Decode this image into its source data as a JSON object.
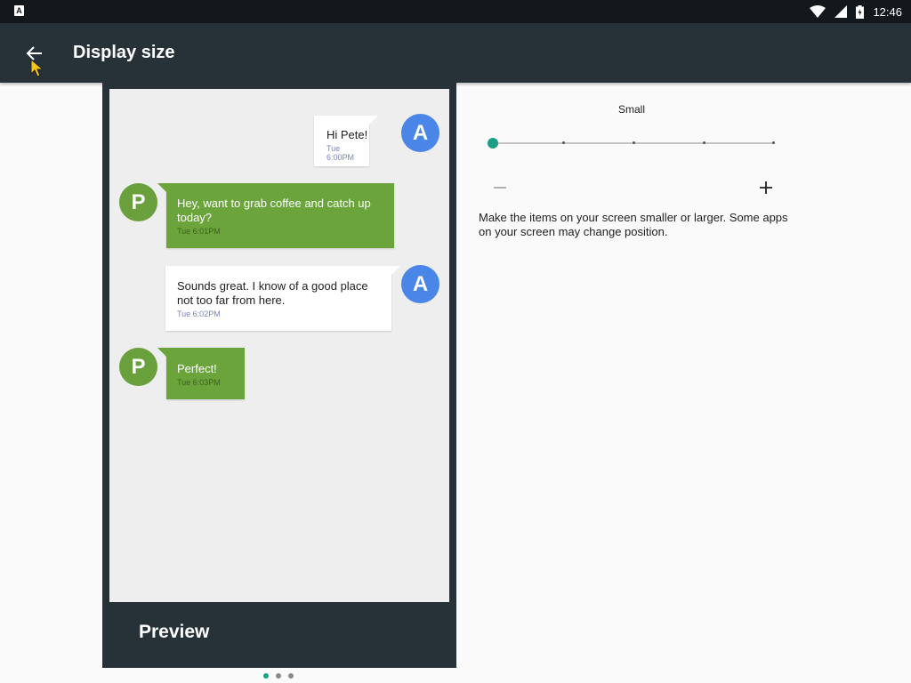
{
  "status_bar": {
    "app_icon_letter": "A",
    "time": "12:46",
    "icons": [
      "wifi-icon",
      "signal-icon",
      "battery-icon"
    ]
  },
  "app_bar": {
    "title": "Display size",
    "back_icon": "arrow-back-icon"
  },
  "preview": {
    "label": "Preview",
    "messages": [
      {
        "from": "A",
        "direction": "out",
        "text": "Hi Pete!",
        "time": "Tue 6:00PM"
      },
      {
        "from": "P",
        "direction": "in",
        "text": "Hey, want to grab coffee and catch up today?",
        "time": "Tue 6:01PM"
      },
      {
        "from": "A",
        "direction": "out",
        "text": "Sounds great. I know of a good place not too far from here.",
        "time": "Tue 6:02PM"
      },
      {
        "from": "P",
        "direction": "in",
        "text": "Perfect!",
        "time": "Tue 6:03PM"
      }
    ]
  },
  "pager": {
    "page_count": 3,
    "active_index": 0
  },
  "settings": {
    "size_label": "Small",
    "slider_steps": 5,
    "slider_selected_index": 0,
    "decrease_label": "–",
    "increase_label": "+",
    "description": "Make the items on your screen smaller or larger. Some apps on your screen may change position."
  },
  "colors": {
    "status_bar": "#13181c",
    "app_bar": "#263238",
    "accent": "#1a9e86",
    "avatar_a": "#4a86e8",
    "avatar_p": "#6aa03b",
    "incoming_bubble": "#6aa43b"
  }
}
